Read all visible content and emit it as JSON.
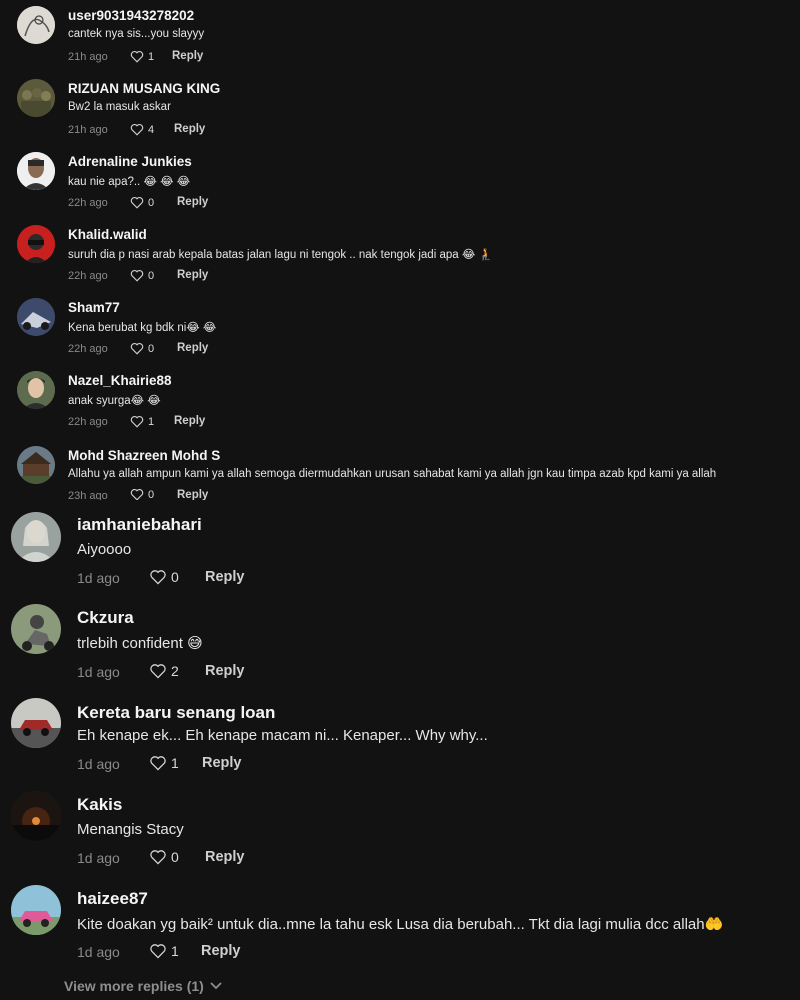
{
  "comments": [
    {
      "username": "user9031943278202",
      "text": "cantek nya sis...you slayyy",
      "time": "21h ago",
      "likes": "1",
      "reply": "Reply",
      "avatar": "avatar-sketch"
    },
    {
      "username": "RIZUAN MUSANG KING",
      "text": "Bw2 la masuk askar",
      "time": "21h ago",
      "likes": "4",
      "reply": "Reply",
      "avatar": "avatar-soldiers"
    },
    {
      "username": "Adrenaline Junkies",
      "text": "kau nie apa?.. 😂 😂 😂",
      "time": "22h ago",
      "likes": "0",
      "reply": "Reply",
      "avatar": "avatar-man"
    },
    {
      "username": "Khalid.walid",
      "text": "suruh dia p nasi arab kepala batas jalan lagu ni tengok .. nak tengok jadi apa 😂 🧎",
      "time": "22h ago",
      "likes": "0",
      "reply": "Reply",
      "avatar": "avatar-red"
    },
    {
      "username": "Sham77",
      "text": "Kena berubat kg bdk ni😂 😂",
      "time": "22h ago",
      "likes": "0",
      "reply": "Reply",
      "avatar": "avatar-bike"
    },
    {
      "username": "Nazel_Khairie88",
      "text": "anak syurga😂 😂",
      "time": "22h ago",
      "likes": "1",
      "reply": "Reply",
      "avatar": "avatar-boy"
    },
    {
      "username": "Mohd Shazreen Mohd S",
      "text": "Allahu ya allah ampun kami ya allah semoga diermudahkan urusan sahabat kami ya allah jgn kau timpa azab kpd kami ya allah",
      "time": "23h ago",
      "likes": "0",
      "reply": "Reply",
      "avatar": "avatar-cabin"
    },
    {
      "username": "iamhaniebahari",
      "text": "Aiyoooo",
      "time": "1d ago",
      "likes": "0",
      "reply": "Reply",
      "avatar": "avatar-woman"
    },
    {
      "username": "Ckzura",
      "text": "trlebih confident 😅",
      "time": "1d ago",
      "likes": "2",
      "reply": "Reply",
      "avatar": "avatar-rider"
    },
    {
      "username": "Kereta baru senang loan",
      "text": "Eh kenape ek... Eh kenape macam ni... Kenaper... Why why...",
      "time": "1d ago",
      "likes": "1",
      "reply": "Reply",
      "avatar": "avatar-car"
    },
    {
      "username": "Kakis",
      "text": "Menangis Stacy",
      "time": "1d ago",
      "likes": "0",
      "reply": "Reply",
      "avatar": "avatar-night"
    },
    {
      "username": "haizee87",
      "text": "Kite doakan yg baik² untuk dia..mne la tahu esk Lusa dia berubah... Tkt dia lagi mulia dcc allah🤲",
      "time": "1d ago",
      "likes": "1",
      "reply": "Reply",
      "avatar": "avatar-pinkcar"
    }
  ],
  "view_more": "View more replies (1)",
  "icons": {
    "like": "heart-outline-icon",
    "expand": "chevron-down-icon"
  }
}
